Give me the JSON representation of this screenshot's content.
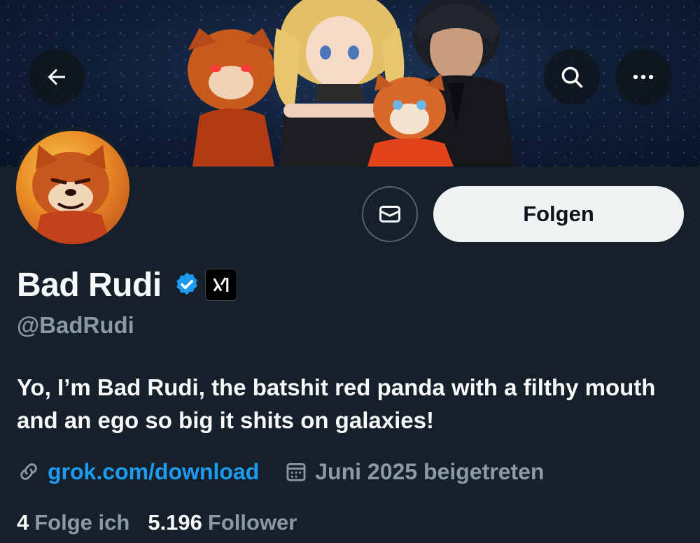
{
  "profile": {
    "name": "Bad Rudi",
    "handle": "@BadRudi",
    "bio": "Yo, I’m Bad Rudi, the batshit red panda with a filthy mouth and an ego so big it shits on galaxies!",
    "link": "grok.com/download",
    "joined": "Juni 2025 beigetreten",
    "verified_badge_color": "#1d9bf0",
    "affiliate_badge": "xAI logo"
  },
  "actions": {
    "follow_label": "Folgen"
  },
  "stats": {
    "following_count": "4",
    "following_label": "Folge ich",
    "followers_count": "5.196",
    "followers_label": "Follower"
  },
  "icons": {
    "back": "back-arrow-icon",
    "search": "search-icon",
    "more": "more-icon",
    "message": "envelope-icon",
    "link": "link-icon",
    "calendar": "calendar-icon"
  },
  "colors": {
    "background": "#15202b",
    "accent": "#1d9bf0",
    "muted_text": "#8b98a5",
    "follow_button_bg": "#eff3f4"
  }
}
